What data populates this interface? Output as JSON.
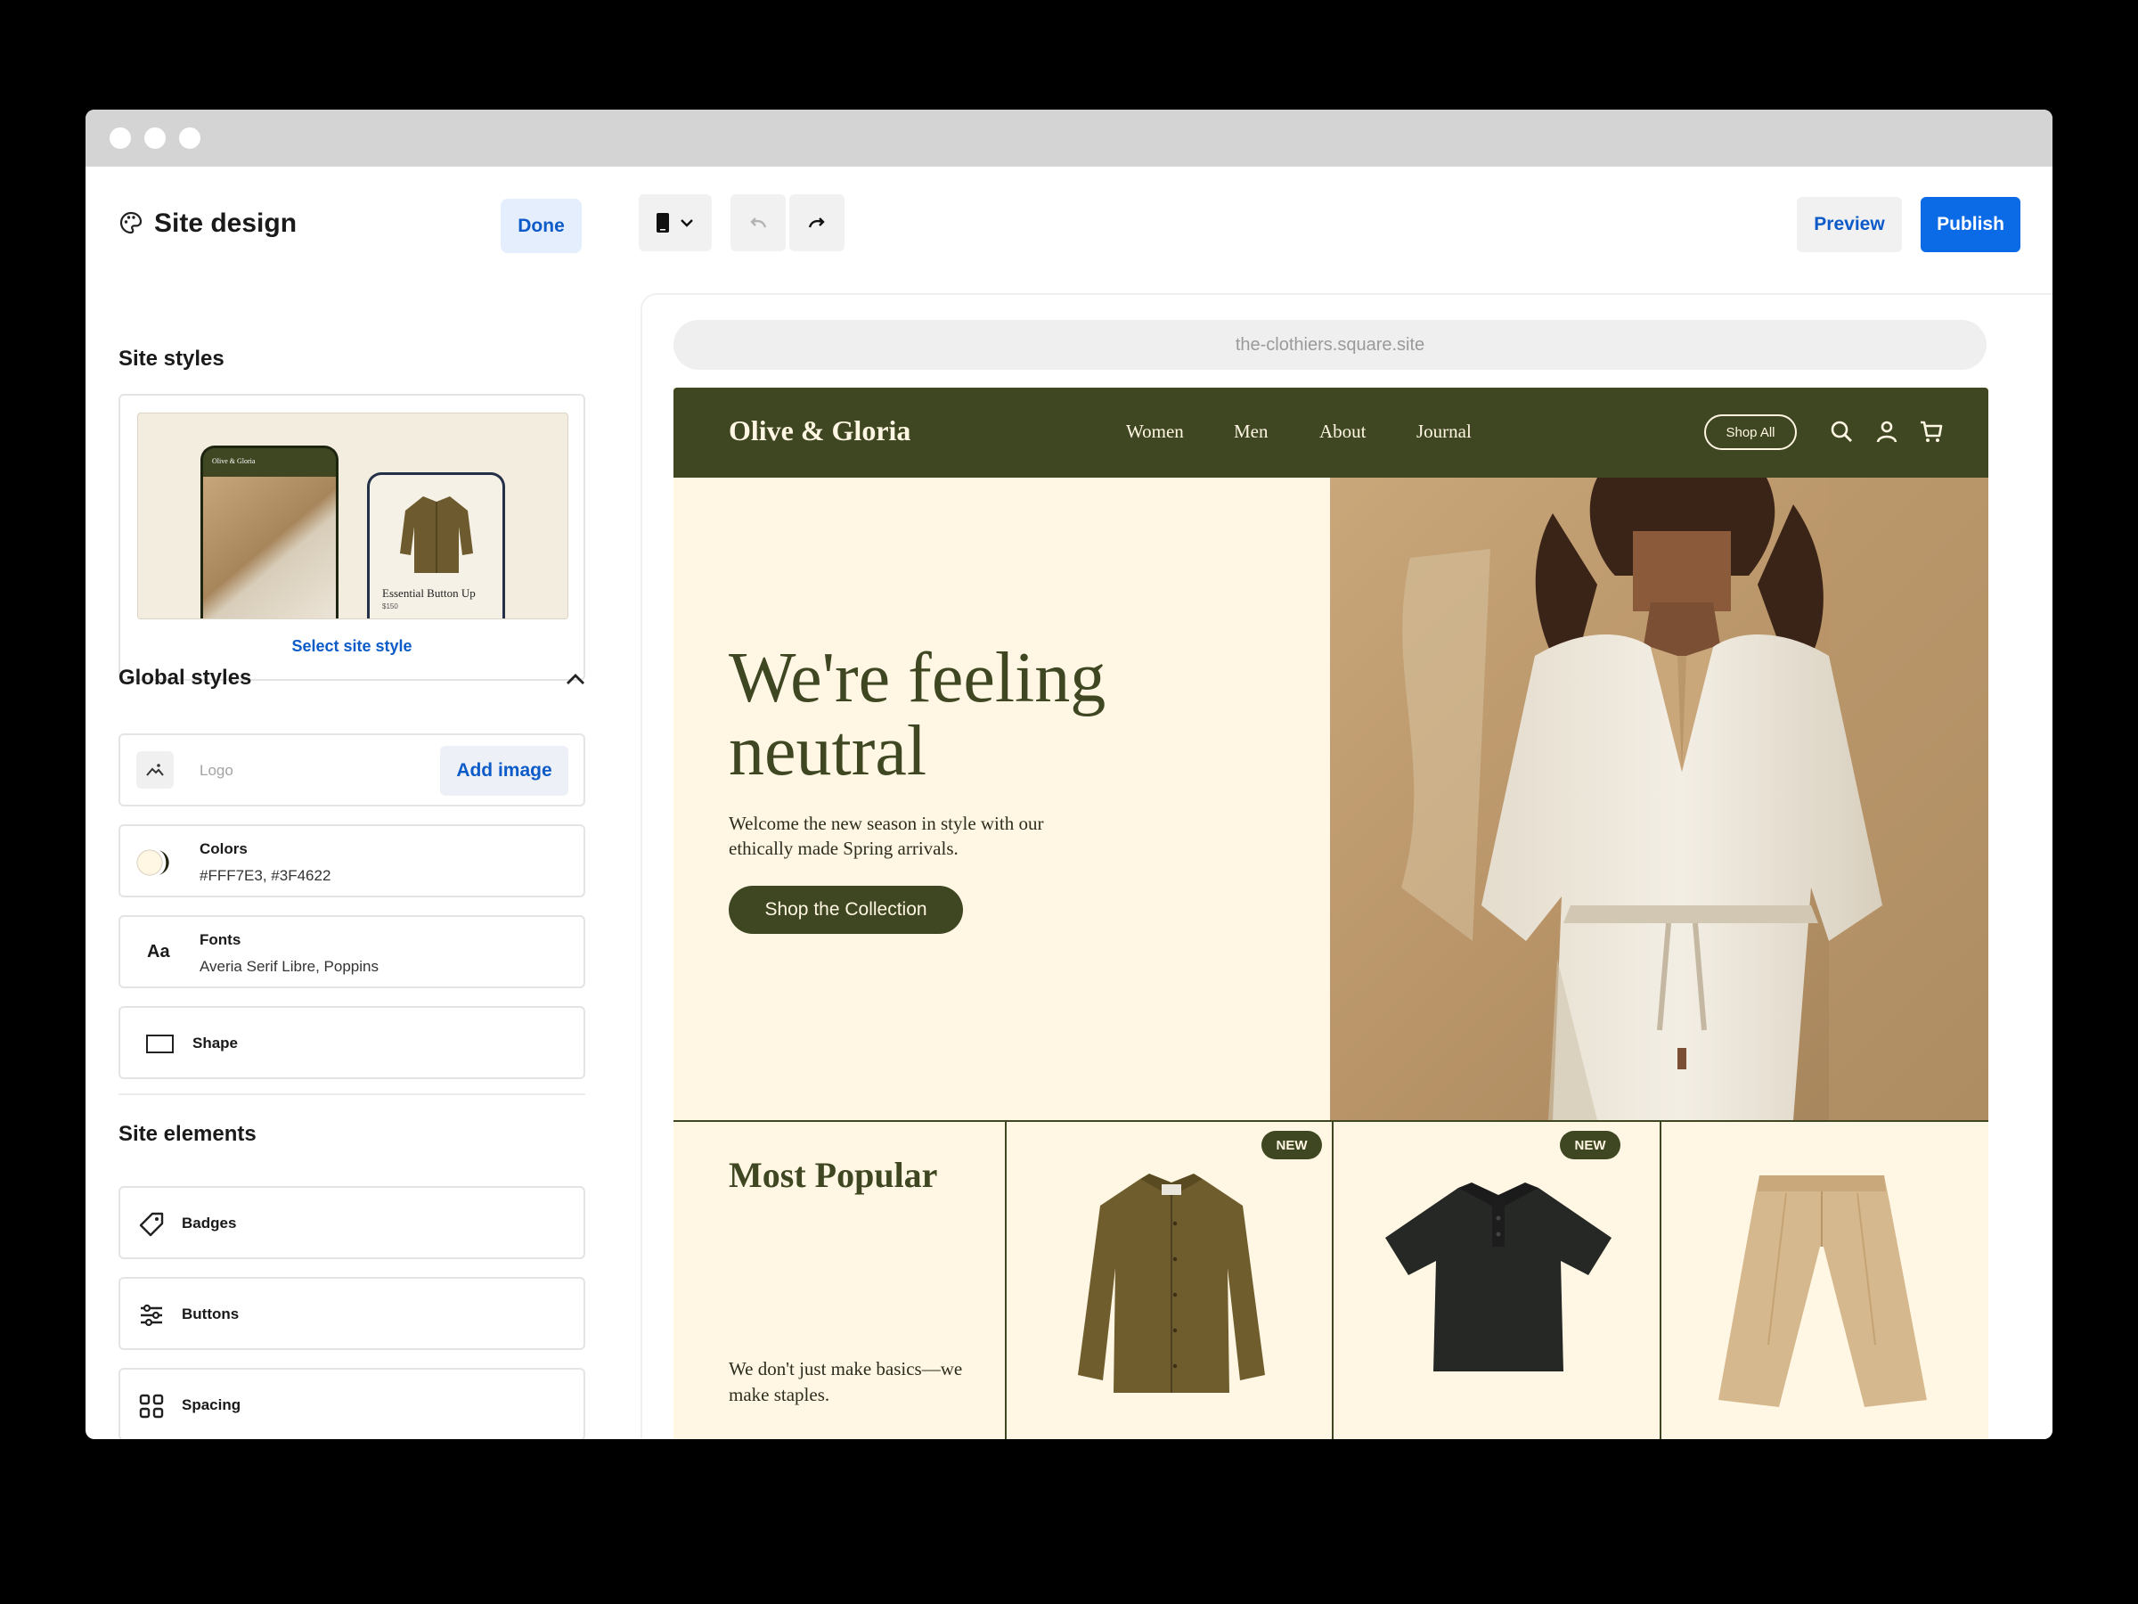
{
  "panel": {
    "title": "Site design",
    "done_label": "Done",
    "site_styles_title": "Site styles",
    "preview_brand": "Olive & Gloria",
    "preview_product_name": "Essential Button Up",
    "preview_product_price": "$150",
    "select_style_label": "Select site style",
    "global_styles_title": "Global styles",
    "logo_placeholder": "Logo",
    "add_image_label": "Add image",
    "colors": {
      "title": "Colors",
      "value": "#FFF7E3, #3F4622",
      "swatch_light": "#FFF7E3",
      "swatch_dark": "#3F4622"
    },
    "fonts": {
      "icon": "Aa",
      "title": "Fonts",
      "value": "Averia Serif Libre, Poppins"
    },
    "shape": {
      "title": "Shape"
    },
    "site_elements_title": "Site elements",
    "elements": [
      {
        "label": "Badges",
        "icon": "tag-icon"
      },
      {
        "label": "Buttons",
        "icon": "sliders-icon"
      },
      {
        "label": "Spacing",
        "icon": "grid-icon"
      }
    ]
  },
  "toolbar": {
    "device_icon": "mobile-device-icon",
    "preview_label": "Preview",
    "publish_label": "Publish"
  },
  "canvas": {
    "url": "the-clothiers.square.site"
  },
  "site": {
    "brand": "Olive & Gloria",
    "nav": [
      "Women",
      "Men",
      "About",
      "Journal"
    ],
    "shop_all_label": "Shop All",
    "hero_title": "We're feeling neutral",
    "hero_subtitle": "Welcome the new season in style with our ethically made Spring arrivals.",
    "hero_cta": "Shop the Collection",
    "popular_title": "Most Popular",
    "popular_subtitle": "We don't just make basics—we make staples.",
    "badge_new": "NEW",
    "colors": {
      "background": "#FFF7E3",
      "primary": "#3F4622"
    }
  }
}
